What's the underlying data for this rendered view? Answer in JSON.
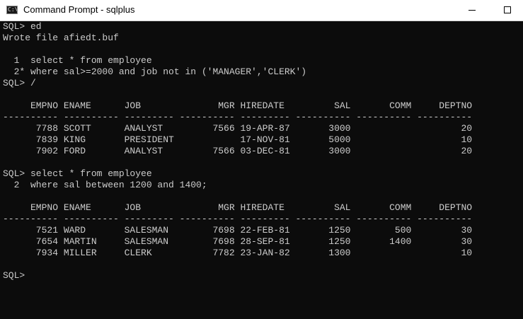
{
  "window": {
    "title": "Command Prompt - sqlplus",
    "icon": "console-app-icon",
    "icon_text": "C:\\",
    "controls": [
      "minimize-icon",
      "maximize-icon"
    ]
  },
  "console": {
    "text_color": "#cccccc",
    "background": "#0c0c0c",
    "lines": [
      "SQL> ed",
      "Wrote file afiedt.buf",
      "",
      "  1  select * from employee",
      "  2* where sal>=2000 and job not in ('MANAGER','CLERK')",
      "SQL> /",
      "",
      "     EMPNO ENAME      JOB              MGR HIREDATE         SAL       COMM     DEPTNO",
      "---------- ---------- --------- ---------- --------- ---------- ---------- ----------",
      "      7788 SCOTT      ANALYST         7566 19-APR-87       3000                    20",
      "      7839 KING       PRESIDENT            17-NOV-81       5000                    10",
      "      7902 FORD       ANALYST         7566 03-DEC-81       3000                    20",
      "",
      "SQL> select * from employee",
      "  2  where sal between 1200 and 1400;",
      "",
      "     EMPNO ENAME      JOB              MGR HIREDATE         SAL       COMM     DEPTNO",
      "---------- ---------- --------- ---------- --------- ---------- ---------- ----------",
      "      7521 WARD       SALESMAN        7698 22-FEB-81       1250        500         30",
      "      7654 MARTIN     SALESMAN        7698 28-SEP-81       1250       1400         30",
      "      7934 MILLER     CLERK           7782 23-JAN-82       1300                    10",
      "",
      "SQL>"
    ]
  }
}
